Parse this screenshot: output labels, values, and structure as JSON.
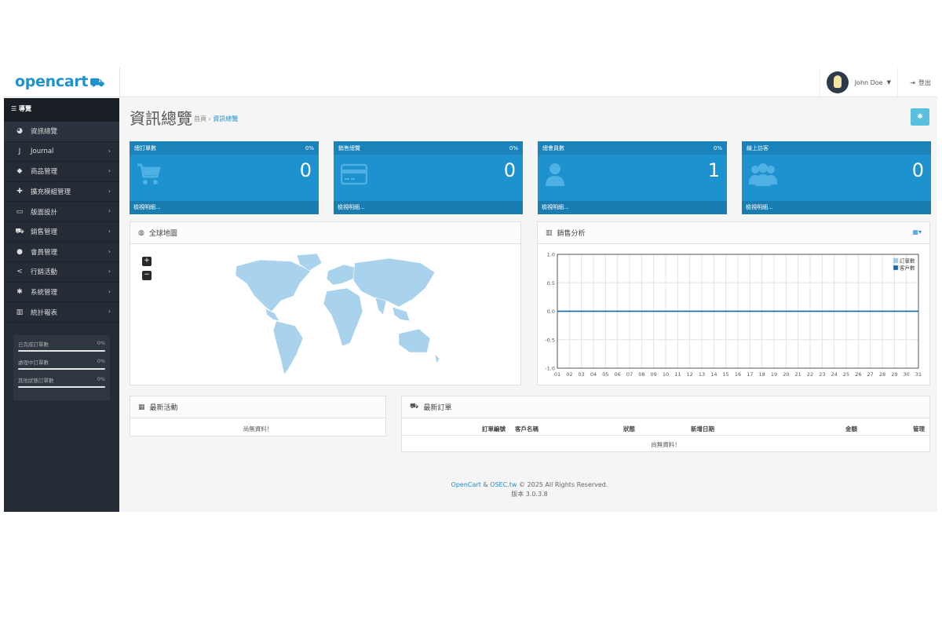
{
  "header": {
    "logo": "opencart",
    "user_name": "John Doe",
    "logout": "登出"
  },
  "sidebar": {
    "title": "導覽",
    "items": [
      {
        "label": "資訊總覽",
        "icon": "dashboard-icon",
        "glyph": "◕",
        "has_arrow": false
      },
      {
        "label": "Journal",
        "icon": "journal-icon",
        "glyph": "J",
        "has_arrow": true
      },
      {
        "label": "商品管理",
        "icon": "tag-icon",
        "glyph": "◆",
        "has_arrow": true
      },
      {
        "label": "擴充模組管理",
        "icon": "puzzle-icon",
        "glyph": "✚",
        "has_arrow": true
      },
      {
        "label": "版面設計",
        "icon": "monitor-icon",
        "glyph": "▭",
        "has_arrow": true
      },
      {
        "label": "銷售管理",
        "icon": "cart-icon",
        "glyph": "⛟",
        "has_arrow": true
      },
      {
        "label": "會員管理",
        "icon": "user-icon",
        "glyph": "●",
        "has_arrow": true
      },
      {
        "label": "行銷活動",
        "icon": "share-icon",
        "glyph": "<",
        "has_arrow": true
      },
      {
        "label": "系統管理",
        "icon": "gear-icon",
        "glyph": "✱",
        "has_arrow": true
      },
      {
        "label": "統計報表",
        "icon": "bar-chart-icon",
        "glyph": "▥",
        "has_arrow": true
      }
    ],
    "stats": [
      {
        "label": "已完成訂單數",
        "value": "0%"
      },
      {
        "label": "處理中訂單數",
        "value": "0%"
      },
      {
        "label": "其他狀態訂單數",
        "value": "0%"
      }
    ]
  },
  "page": {
    "title": "資訊總覽",
    "breadcrumb_home": "首頁",
    "breadcrumb_current": "資訊總覽"
  },
  "tiles": [
    {
      "title": "總訂單數",
      "percent": "0%",
      "value": "0",
      "link": "檢視明細...",
      "icon": "cart-icon"
    },
    {
      "title": "銷售總覽",
      "percent": "0%",
      "value": "0",
      "link": "檢視明細...",
      "icon": "credit-card-icon"
    },
    {
      "title": "總會員數",
      "percent": "0%",
      "value": "1",
      "link": "檢視明細...",
      "icon": "user-icon"
    },
    {
      "title": "線上訪客",
      "percent": "",
      "value": "0",
      "link": "檢視明細...",
      "icon": "users-icon"
    }
  ],
  "map_panel": {
    "title": "全球地圖",
    "zoom_in": "+",
    "zoom_out": "−"
  },
  "chart_panel": {
    "title": "銷售分析"
  },
  "chart_data": {
    "type": "line",
    "categories": [
      "01",
      "02",
      "03",
      "04",
      "05",
      "06",
      "07",
      "08",
      "09",
      "10",
      "11",
      "12",
      "13",
      "14",
      "15",
      "16",
      "17",
      "18",
      "19",
      "20",
      "21",
      "22",
      "23",
      "24",
      "25",
      "26",
      "27",
      "28",
      "29",
      "30",
      "31"
    ],
    "series": [
      {
        "name": "訂單數",
        "color": "#9bcbe8",
        "values": [
          0,
          0,
          0,
          0,
          0,
          0,
          0,
          0,
          0,
          0,
          0,
          0,
          0,
          0,
          0,
          0,
          0,
          0,
          0,
          0,
          0,
          0,
          0,
          0,
          0,
          0,
          0,
          0,
          0,
          0,
          0
        ]
      },
      {
        "name": "客戶數",
        "color": "#1065a8",
        "values": [
          0,
          0,
          0,
          0,
          0,
          0,
          0,
          0,
          0,
          0,
          0,
          0,
          0,
          0,
          0,
          0,
          0,
          0,
          0,
          0,
          0,
          0,
          0,
          0,
          0,
          0,
          0,
          0,
          0,
          0,
          0
        ]
      }
    ],
    "yticks": [
      "1.0",
      "0.5",
      "0.0",
      "-0.5",
      "-1.0"
    ],
    "ylim": [
      -1,
      1
    ],
    "legend": "top-right",
    "grid": true
  },
  "activity_panel": {
    "title": "最新活動",
    "empty": "尚無資料！"
  },
  "orders_panel": {
    "title": "最新訂單",
    "columns": [
      "訂單編號",
      "客戶名稱",
      "狀態",
      "新增日期",
      "金額",
      "管理"
    ],
    "empty": "尚無資料！"
  },
  "footer": {
    "link1": "OpenCart",
    "amp": "&",
    "link2": "OSEC.tw",
    "rights": "© 2025 All Rights Reserved.",
    "version": "版本 3.0.3.8"
  }
}
